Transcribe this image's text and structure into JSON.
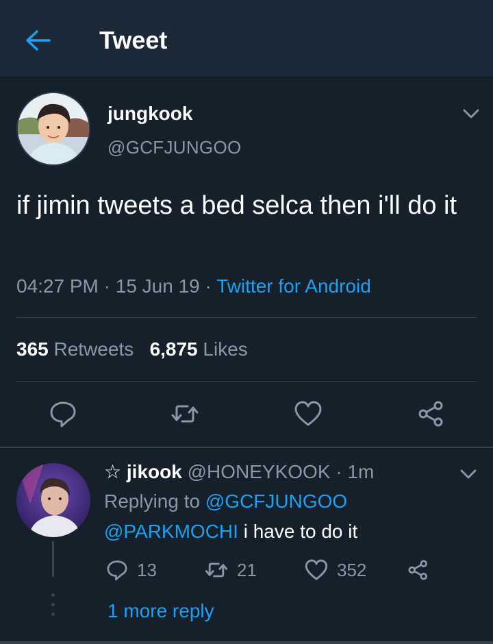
{
  "header": {
    "title": "Tweet"
  },
  "tweet": {
    "author_name": "jungkook",
    "author_handle": "@GCFJUNGOO",
    "text": "if jimin tweets a bed selca then i'll do it",
    "time": "04:27 PM",
    "dot1": " · ",
    "date": "15 Jun 19",
    "dot2": " · ",
    "source": "Twitter for Android",
    "retweets_count": "365",
    "retweets_label": "Retweets",
    "likes_count": "6,875",
    "likes_label": "Likes"
  },
  "reply": {
    "star": "☆",
    "name": "jikook",
    "handle": "@HONEYKOOK · 1m",
    "replying_prefix": "Replying to",
    "replying_to": "@GCFJUNGOO",
    "mention": "@PARKMOCHI",
    "text": "i have to do it",
    "reply_count": "13",
    "retweet_count": "21",
    "like_count": "352",
    "more_replies": "1 more reply"
  },
  "colors": {
    "background": "#15202b",
    "header": "#1c2938",
    "accent": "#1da1f2",
    "secondary_text": "#8899a6",
    "divider": "#38444d"
  },
  "icons": [
    "back-arrow-icon",
    "chevron-down-icon",
    "reply-icon",
    "retweet-icon",
    "like-icon",
    "share-icon"
  ]
}
